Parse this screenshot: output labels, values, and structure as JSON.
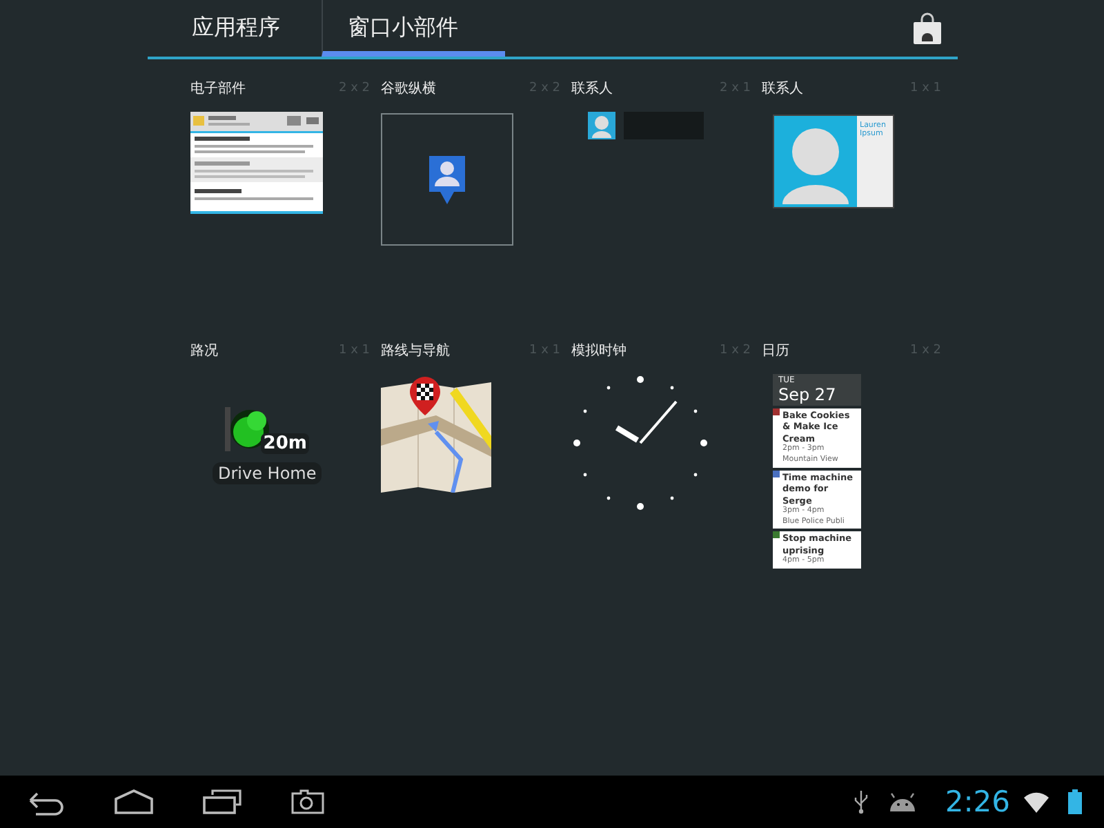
{
  "tabs": [
    {
      "label": "应用程序",
      "selected": false
    },
    {
      "label": "窗口小部件",
      "selected": true
    }
  ],
  "widgets": [
    {
      "name": "电子部件",
      "size": "2 x 2",
      "kind": "email"
    },
    {
      "name": "谷歌纵横",
      "size": "2 x 2",
      "kind": "latitude"
    },
    {
      "name": "联系人",
      "size": "2 x 1",
      "kind": "contact-small"
    },
    {
      "name": "联系人",
      "size": "1 x 1",
      "kind": "contact-card",
      "card_name": "Lauren Ipsum"
    },
    {
      "name": "路况",
      "size": "1 x 1",
      "kind": "traffic",
      "eta": "20m",
      "label": "Drive Home"
    },
    {
      "name": "路线与导航",
      "size": "1 x 1",
      "kind": "navigation"
    },
    {
      "name": "模拟时钟",
      "size": "1 x 2",
      "kind": "clock"
    },
    {
      "name": "日历",
      "size": "1 x 2",
      "kind": "calendar",
      "day": "TUE",
      "date": "Sep 27",
      "events": [
        {
          "title": "Bake Cookies & Make Ice Cream",
          "time": "2pm - 3pm",
          "place": "Mountain View",
          "color": "#a03030"
        },
        {
          "title": "Time machine demo for Serge",
          "time": "3pm - 4pm",
          "place": "Blue Police Publi",
          "color": "#4a70c0"
        },
        {
          "title": "Stop machine uprising",
          "time": "4pm - 5pm",
          "color": "#3a7a30"
        }
      ]
    }
  ],
  "status_bar": {
    "time": "2:26"
  }
}
